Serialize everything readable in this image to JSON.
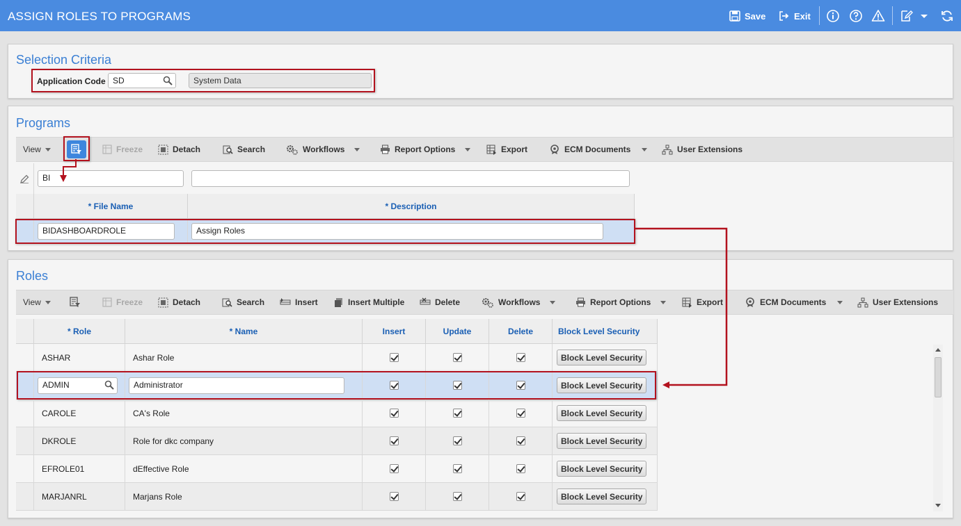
{
  "header": {
    "title": "ASSIGN ROLES TO PROGRAMS",
    "save_label": "Save",
    "exit_label": "Exit",
    "accent_color": "#4a8be0"
  },
  "selection": {
    "title": "Selection Criteria",
    "app_code_label": "Application Code",
    "app_code_value": "SD",
    "app_code_description": "System Data"
  },
  "programs": {
    "title": "Programs",
    "toolbar": {
      "view": "View",
      "freeze": "Freeze",
      "detach": "Detach",
      "search": "Search",
      "workflows": "Workflows",
      "report_options": "Report Options",
      "export": "Export",
      "ecm_documents": "ECM Documents",
      "user_extensions": "User Extensions"
    },
    "filter": {
      "file_name": "BI",
      "description": ""
    },
    "columns": {
      "file_name": "* File Name",
      "description": "* Description"
    },
    "rows": [
      {
        "file_name": "BIDASHBOARDROLE",
        "description": "Assign Roles"
      }
    ]
  },
  "roles": {
    "title": "Roles",
    "toolbar": {
      "view": "View",
      "freeze": "Freeze",
      "detach": "Detach",
      "search": "Search",
      "insert": "Insert",
      "insert_multiple": "Insert Multiple",
      "delete": "Delete",
      "workflows": "Workflows",
      "report_options": "Report Options",
      "export": "Export",
      "ecm_documents": "ECM Documents",
      "user_extensions": "User Extensions"
    },
    "columns": {
      "role": "* Role",
      "name": "* Name",
      "insert": "Insert",
      "update": "Update",
      "delete": "Delete",
      "bls": "Block Level Security"
    },
    "button_label": "Block Level Security",
    "rows": [
      {
        "role": "ASHAR",
        "name": "Ashar Role",
        "insert": true,
        "update": true,
        "delete": true
      },
      {
        "role": "ADMIN",
        "name": "Administrator",
        "insert": true,
        "update": true,
        "delete": true
      },
      {
        "role": "CAROLE",
        "name": "CA's Role",
        "insert": true,
        "update": true,
        "delete": true
      },
      {
        "role": "DKROLE",
        "name": "Role for dkc company",
        "insert": true,
        "update": true,
        "delete": true
      },
      {
        "role": "EFROLE01",
        "name": "dEffective Role",
        "insert": true,
        "update": true,
        "delete": true
      },
      {
        "role": "MARJANRL",
        "name": "Marjans Role",
        "insert": true,
        "update": true,
        "delete": true
      }
    ]
  },
  "annotation_color": "#b3121e"
}
